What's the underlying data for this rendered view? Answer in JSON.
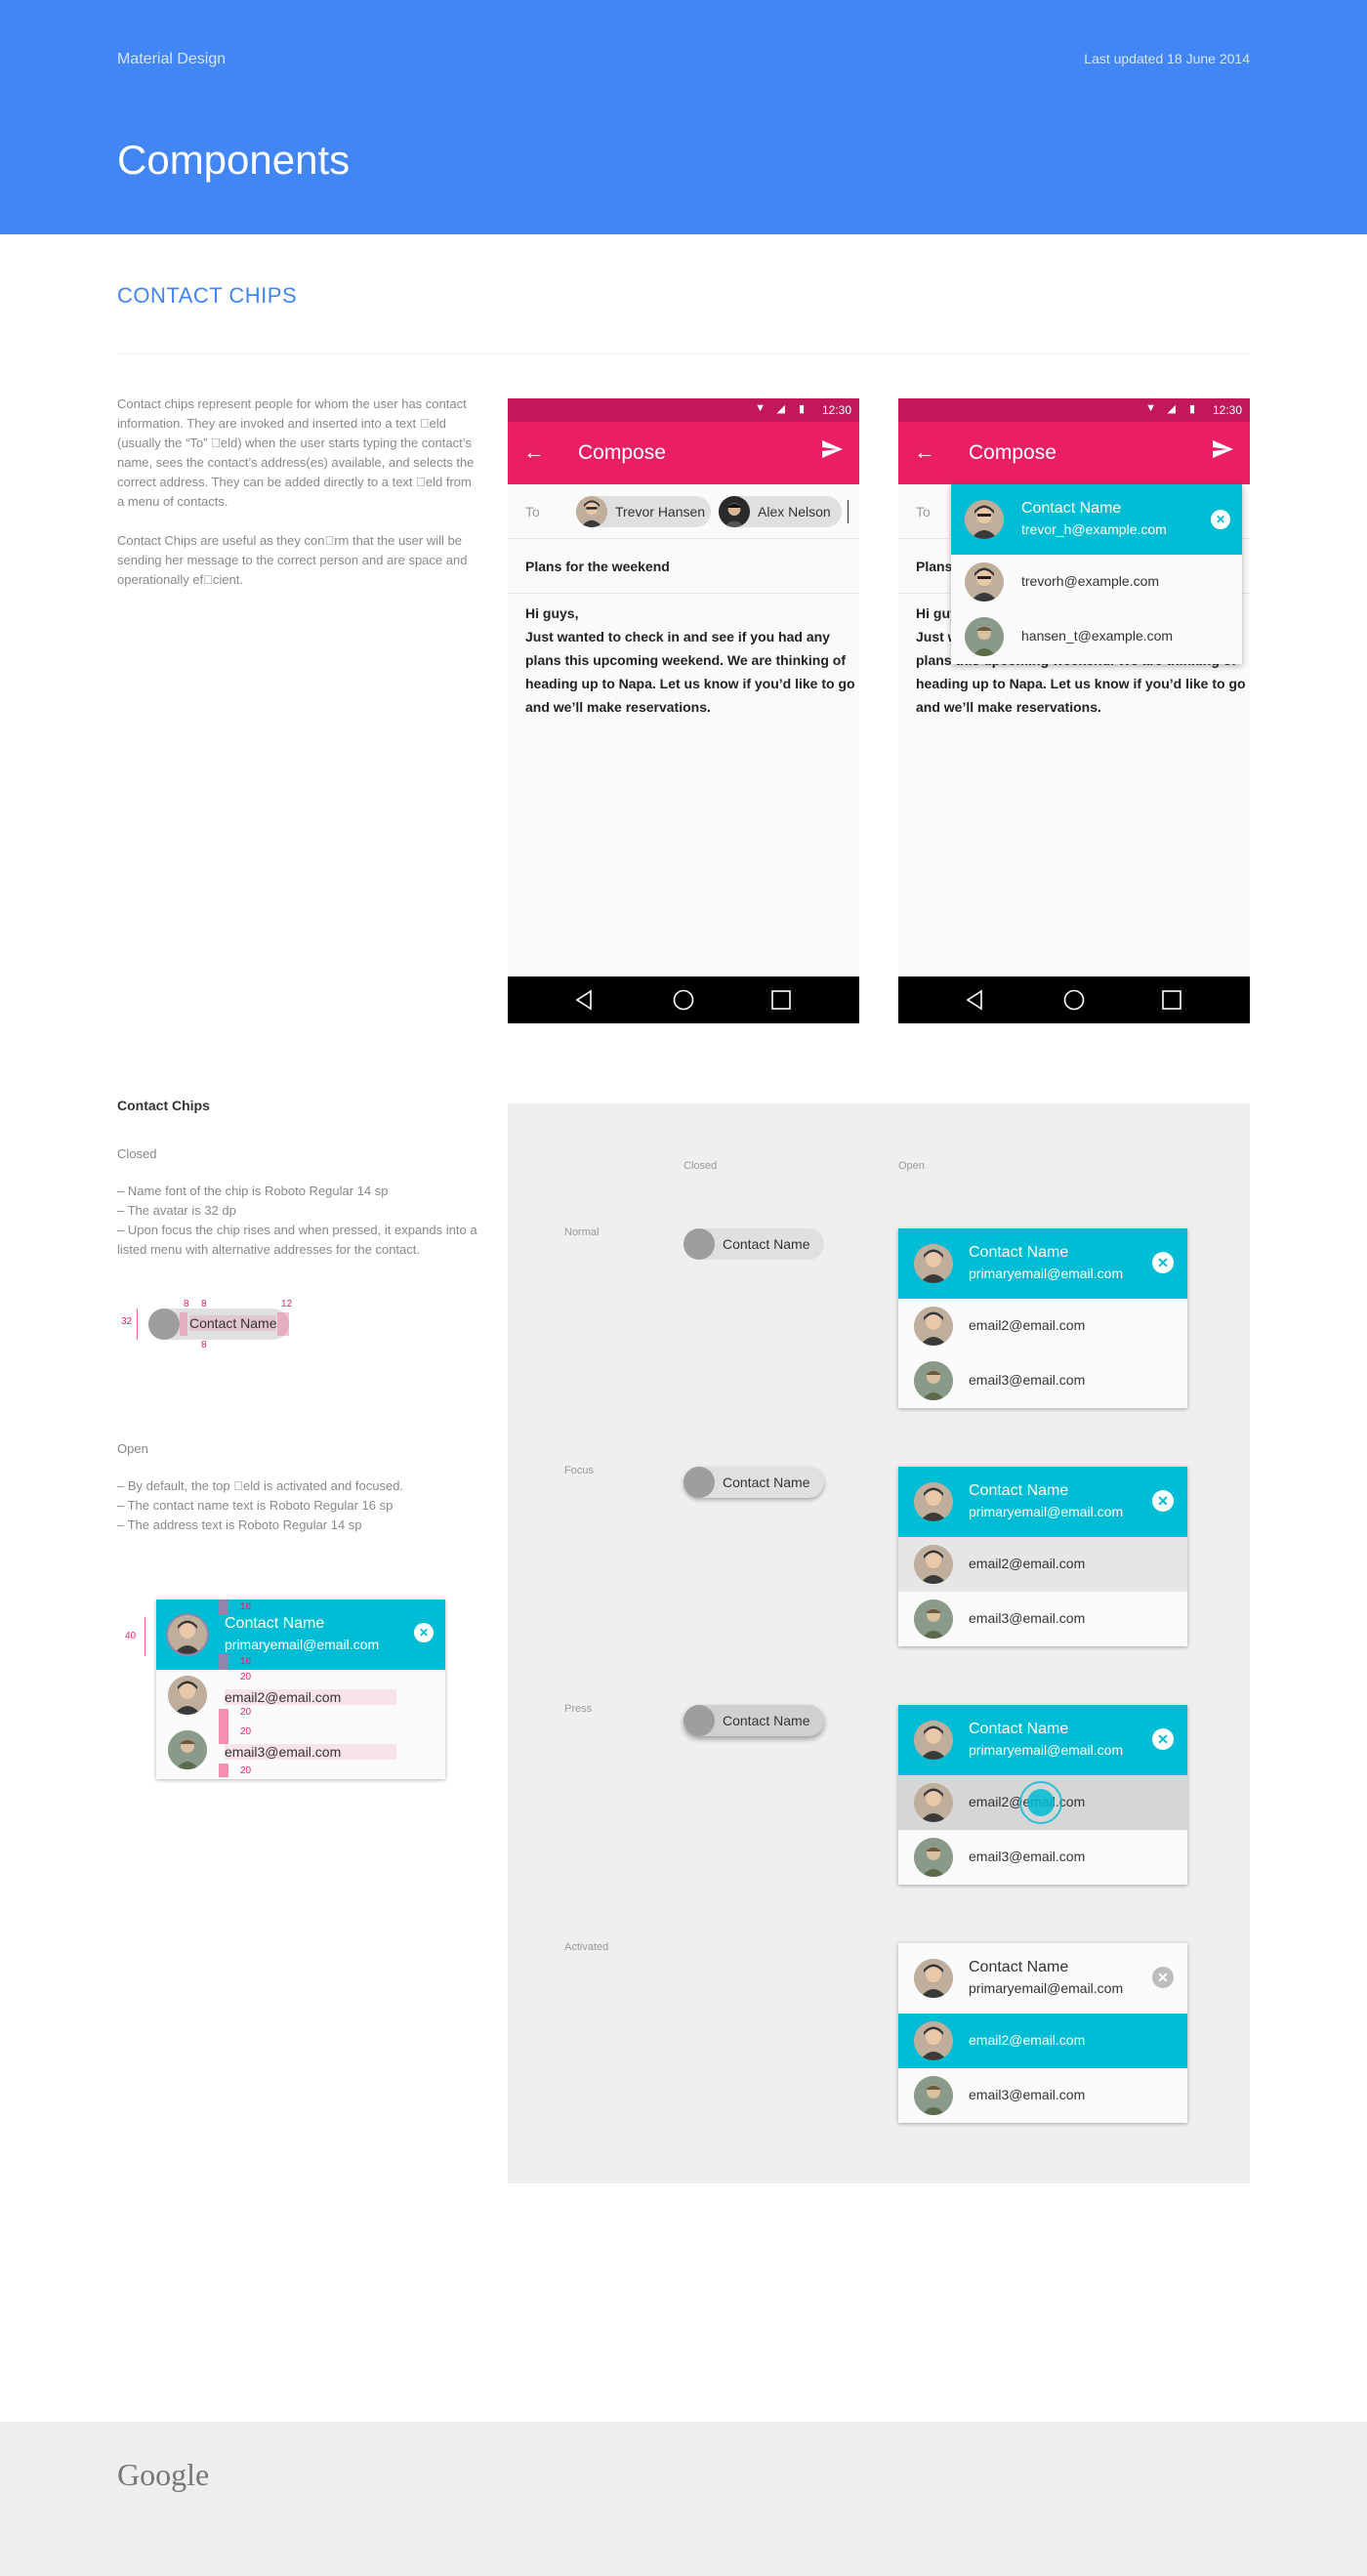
{
  "header": {
    "brand": "Material Design",
    "updated": "Last updated 18 June 2014",
    "title": "Components"
  },
  "section_title": "CONTACT CHIPS",
  "intro": [
    "Contact chips represent people for whom the user has contact information. They are invoked and inserted into a text \u0000eld (usually the “To” \u0000eld) when the user starts typing the contact’s name, sees the contact’s address(es) available, and selects the correct address. They can be added directly to a text \u0000eld from a menu of contacts.",
    "Contact Chips are useful as they con\u0000rm that the user will be sending her message to the correct person and are space and operationally ef\u0000cient."
  ],
  "phone": {
    "time": "12:30",
    "title": "Compose",
    "to_label": "To",
    "chips": [
      "Trevor Hansen",
      "Alex Nelson"
    ],
    "subject": "Plans for the weekend",
    "body": [
      "Hi guys,",
      "Just wanted to check in and see if you had any plans this upcoming weekend. We are thinking of heading up to Napa. Let us know if you’d like to go and we’ll make reservations."
    ],
    "dropdown": {
      "name": "Contact Name",
      "email": "trevor_h@example.com",
      "rows": [
        "trevorh@example.com",
        "hansen_t@example.com"
      ]
    },
    "subject_partial": "Plans",
    "body_partial": [
      "Hi gu",
      "Just w",
      "plans"
    ]
  },
  "specs": {
    "heading": "Contact Chips",
    "closed_label": "Closed",
    "closed_bullets": [
      "–  Name font of the chip is Roboto Regular 14 sp",
      "–  The avatar is 32 dp",
      "–  Upon focus the chip rises and when pressed, it expands into a listed menu with alternative  addresses for the contact."
    ],
    "open_label": "Open",
    "open_bullets": [
      "–  By default, the top \u0000eld is activated and focused.",
      "–  The contact name text is Roboto Regular 16 sp",
      "–  The address text is Roboto Regular 14 sp"
    ],
    "redline_chip": "Contact Name",
    "redline_card": {
      "name": "Contact Name",
      "email": "primaryemail@email.com",
      "rows": [
        "email2@email.com",
        "email3@email.com"
      ]
    },
    "redline_marks": {
      "m32": "32",
      "m8a": "8",
      "m8b": "8",
      "m8c": "8",
      "m12": "12",
      "m40": "40",
      "m16a": "16",
      "m16b": "16",
      "m20a": "20",
      "m20b": "20",
      "m20c": "20",
      "m20d": "20"
    }
  },
  "panel": {
    "col_closed": "Closed",
    "col_open": "Open",
    "chip_label": "Contact Name",
    "states": [
      "Normal",
      "Focus",
      "Press",
      "Activated"
    ],
    "card": {
      "name": "Contact Name",
      "email": "primaryemail@email.com",
      "rows": [
        "email2@email.com",
        "email3@email.com"
      ]
    }
  },
  "footer": {
    "logo": "Google"
  },
  "colors": {
    "blue": "#4285f4",
    "pink": "#e91e63",
    "pink_dark": "#c2185b",
    "cyan": "#00bcd4"
  }
}
